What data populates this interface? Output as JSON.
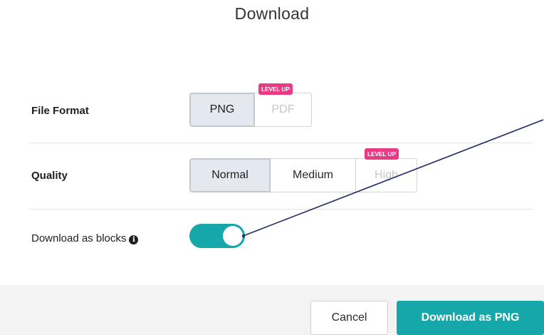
{
  "dialog": {
    "title": "Download"
  },
  "file_format": {
    "label": "File Format",
    "options": [
      "PNG",
      "PDF"
    ],
    "selected": "PNG",
    "badge": "LEVEL UP"
  },
  "quality": {
    "label": "Quality",
    "options": [
      "Normal",
      "Medium",
      "High"
    ],
    "selected": "Normal",
    "badge": "LEVEL UP"
  },
  "blocks": {
    "label": "Download as blocks",
    "info_glyph": "i",
    "toggle_on": true
  },
  "footer": {
    "cancel_label": "Cancel",
    "download_label": "Download as PNG"
  },
  "colors": {
    "accent": "#15a7a9",
    "badge": "#ea3a84",
    "annotation_arrow": "#1b2a6b"
  }
}
